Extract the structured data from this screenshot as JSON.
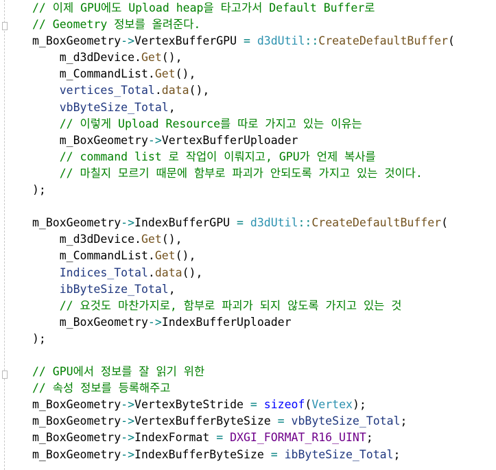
{
  "editor": {
    "lines": [
      [
        {
          "t": "// 이제 GPU에도 Upload heap을 타고가서 Default Buffer로",
          "c": "comment"
        }
      ],
      [
        {
          "t": "// Geometry 정보를 올려준다.",
          "c": "comment"
        }
      ],
      [
        {
          "t": "m_BoxGeometry",
          "c": "plain"
        },
        {
          "t": "->",
          "c": "op"
        },
        {
          "t": "VertexBufferGPU ",
          "c": "plain"
        },
        {
          "t": "= ",
          "c": "op"
        },
        {
          "t": "d3dUtil",
          "c": "type"
        },
        {
          "t": "::",
          "c": "op"
        },
        {
          "t": "CreateDefaultBuffer",
          "c": "func"
        },
        {
          "t": "(",
          "c": "plain"
        }
      ],
      [
        {
          "t": "    m_d3dDevice.",
          "c": "plain"
        },
        {
          "t": "Get",
          "c": "func"
        },
        {
          "t": "(),",
          "c": "plain"
        }
      ],
      [
        {
          "t": "    m_CommandList.",
          "c": "plain"
        },
        {
          "t": "Get",
          "c": "func"
        },
        {
          "t": "(),",
          "c": "plain"
        }
      ],
      [
        {
          "t": "    ",
          "c": "plain"
        },
        {
          "t": "vertices_Total",
          "c": "member"
        },
        {
          "t": ".",
          "c": "plain"
        },
        {
          "t": "data",
          "c": "func"
        },
        {
          "t": "(),",
          "c": "plain"
        }
      ],
      [
        {
          "t": "    ",
          "c": "plain"
        },
        {
          "t": "vbByteSize_Total",
          "c": "member"
        },
        {
          "t": ",",
          "c": "plain"
        }
      ],
      [
        {
          "t": "    // 이렇게 Upload Resource를 따로 가지고 있는 이유는",
          "c": "comment"
        }
      ],
      [
        {
          "t": "    m_BoxGeometry",
          "c": "plain"
        },
        {
          "t": "->",
          "c": "op"
        },
        {
          "t": "VertexBufferUploader",
          "c": "plain"
        }
      ],
      [
        {
          "t": "    // command list 로 작업이 이뤄지고, GPU가 언제 복사를",
          "c": "comment"
        }
      ],
      [
        {
          "t": "    // 마칠지 모르기 때문에 함부로 파괴가 안되도록 가지고 있는 것이다.",
          "c": "comment"
        }
      ],
      [
        {
          "t": ");",
          "c": "plain"
        }
      ],
      [
        {
          "t": "",
          "c": "plain"
        }
      ],
      [
        {
          "t": "m_BoxGeometry",
          "c": "plain"
        },
        {
          "t": "->",
          "c": "op"
        },
        {
          "t": "IndexBufferGPU ",
          "c": "plain"
        },
        {
          "t": "= ",
          "c": "op"
        },
        {
          "t": "d3dUtil",
          "c": "type"
        },
        {
          "t": "::",
          "c": "op"
        },
        {
          "t": "CreateDefaultBuffer",
          "c": "func"
        },
        {
          "t": "(",
          "c": "plain"
        }
      ],
      [
        {
          "t": "    m_d3dDevice.",
          "c": "plain"
        },
        {
          "t": "Get",
          "c": "func"
        },
        {
          "t": "(),",
          "c": "plain"
        }
      ],
      [
        {
          "t": "    m_CommandList.",
          "c": "plain"
        },
        {
          "t": "Get",
          "c": "func"
        },
        {
          "t": "(),",
          "c": "plain"
        }
      ],
      [
        {
          "t": "    ",
          "c": "plain"
        },
        {
          "t": "Indices_Total",
          "c": "member"
        },
        {
          "t": ".",
          "c": "plain"
        },
        {
          "t": "data",
          "c": "func"
        },
        {
          "t": "(),",
          "c": "plain"
        }
      ],
      [
        {
          "t": "    ",
          "c": "plain"
        },
        {
          "t": "ibByteSize_Total",
          "c": "member"
        },
        {
          "t": ",",
          "c": "plain"
        }
      ],
      [
        {
          "t": "    // 요것도 마찬가지로, 함부로 파괴가 되지 않도록 가지고 있는 것",
          "c": "comment"
        }
      ],
      [
        {
          "t": "    m_BoxGeometry",
          "c": "plain"
        },
        {
          "t": "->",
          "c": "op"
        },
        {
          "t": "IndexBufferUploader",
          "c": "plain"
        }
      ],
      [
        {
          "t": ");",
          "c": "plain"
        }
      ],
      [
        {
          "t": "",
          "c": "plain"
        }
      ],
      [
        {
          "t": "// GPU에서 정보를 잘 읽기 위한",
          "c": "comment"
        }
      ],
      [
        {
          "t": "// 속성 정보를 등록해주고",
          "c": "comment"
        }
      ],
      [
        {
          "t": "m_BoxGeometry",
          "c": "plain"
        },
        {
          "t": "->",
          "c": "op"
        },
        {
          "t": "VertexByteStride ",
          "c": "plain"
        },
        {
          "t": "= ",
          "c": "op"
        },
        {
          "t": "sizeof",
          "c": "keyword"
        },
        {
          "t": "(",
          "c": "plain"
        },
        {
          "t": "Vertex",
          "c": "type"
        },
        {
          "t": ");",
          "c": "plain"
        }
      ],
      [
        {
          "t": "m_BoxGeometry",
          "c": "plain"
        },
        {
          "t": "->",
          "c": "op"
        },
        {
          "t": "VertexBufferByteSize ",
          "c": "plain"
        },
        {
          "t": "= ",
          "c": "op"
        },
        {
          "t": "vbByteSize_Total",
          "c": "member"
        },
        {
          "t": ";",
          "c": "plain"
        }
      ],
      [
        {
          "t": "m_BoxGeometry",
          "c": "plain"
        },
        {
          "t": "->",
          "c": "op"
        },
        {
          "t": "IndexFormat ",
          "c": "plain"
        },
        {
          "t": "= ",
          "c": "op"
        },
        {
          "t": "DXGI_FORMAT_R16_UINT",
          "c": "macro"
        },
        {
          "t": ";",
          "c": "plain"
        }
      ],
      [
        {
          "t": "m_BoxGeometry",
          "c": "plain"
        },
        {
          "t": "->",
          "c": "op"
        },
        {
          "t": "IndexBufferByteSize ",
          "c": "plain"
        },
        {
          "t": "= ",
          "c": "op"
        },
        {
          "t": "ibByteSize_Total",
          "c": "member"
        },
        {
          "t": ";",
          "c": "plain"
        }
      ]
    ]
  }
}
